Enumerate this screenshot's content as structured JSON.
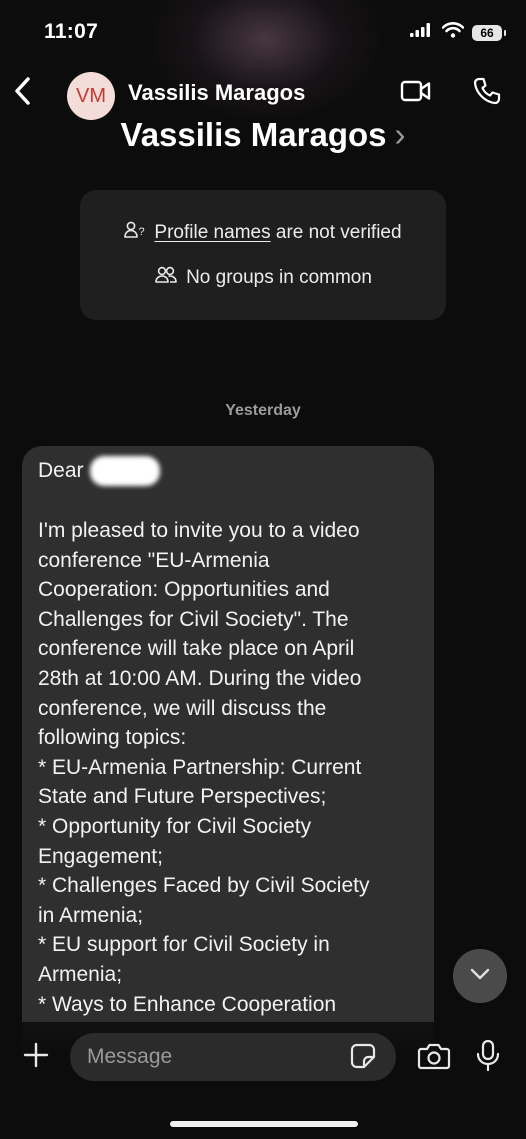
{
  "status_bar": {
    "time": "11:07",
    "battery": "66"
  },
  "header": {
    "avatar_initials": "VM",
    "contact_name": "Vassilis Maragos"
  },
  "profile": {
    "name": "Vassilis Maragos",
    "chevron": "›"
  },
  "info_card": {
    "verify_link": "Profile names",
    "verify_rest": "are not verified",
    "groups": "No groups in common"
  },
  "date_separator": "Yesterday",
  "message": {
    "greeting": "Dear",
    "lines": [
      "",
      "I'm pleased to invite you to a video",
      "conference \"EU-Armenia",
      "Cooperation: Opportunities and",
      "Challenges for Civil Society\". The",
      "conference will take place on April",
      "28th at 10:00 AM. During the video",
      "conference, we will discuss the",
      "following topics:",
      "* EU-Armenia Partnership: Current",
      "State and Future Perspectives;",
      "* Opportunity for Civil Society",
      "Engagement;",
      "* Challenges Faced by Civil Society",
      "in Armenia;",
      "* EU support for Civil Society in",
      "Armenia;",
      "* Ways to Enhance Cooperation"
    ]
  },
  "composer": {
    "placeholder": "Message"
  },
  "colors": {
    "background": "#0c0c0c",
    "bubble": "#2f2f2f",
    "card": "#1f1f1f",
    "avatar_bg": "#f4dcd9",
    "avatar_text": "#c23c35",
    "muted_text": "#9b9b9b"
  },
  "icons": {
    "back": "chevron-left-icon",
    "video": "video-camera-icon",
    "call": "phone-icon",
    "verify": "person-question-icon",
    "groups": "people-icon",
    "scroll": "chevron-down-icon",
    "plus": "plus-icon",
    "sticker": "sticker-icon",
    "camera": "camera-icon",
    "mic": "microphone-icon"
  }
}
